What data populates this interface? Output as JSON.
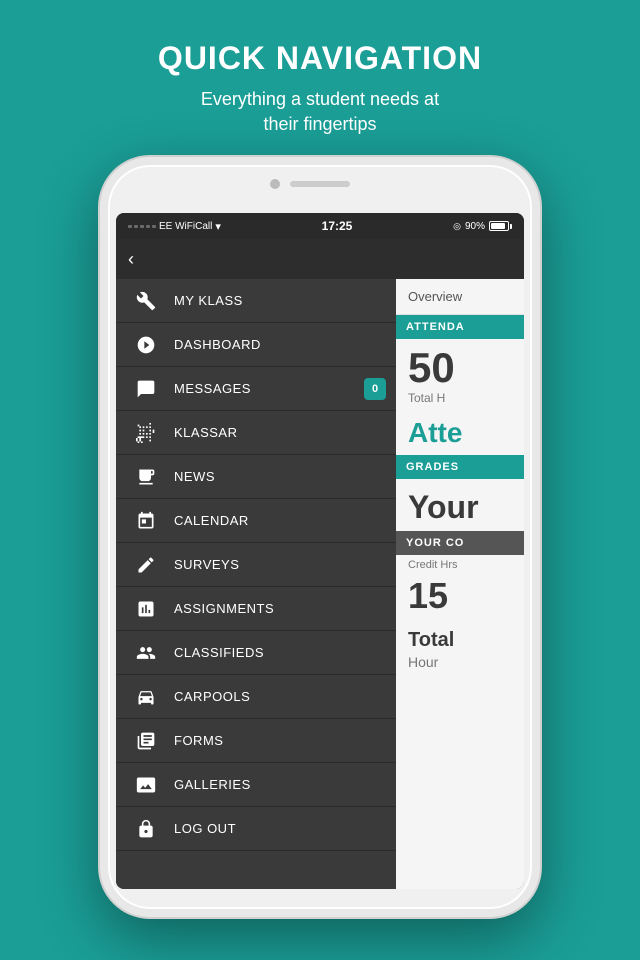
{
  "page": {
    "title": "QUICK NAVIGATION",
    "subtitle": "Everything a student needs at\ntheir fingertips"
  },
  "statusBar": {
    "carrier": "EE WiFiCall",
    "time": "17:25",
    "battery": "90%",
    "signal": "●●●●○"
  },
  "navBar": {
    "backLabel": "‹"
  },
  "menu": {
    "items": [
      {
        "id": "my-klass",
        "label": "MY KLASS",
        "icon": "wrench",
        "badge": null
      },
      {
        "id": "dashboard",
        "label": "DASHBOARD",
        "icon": "dashboard",
        "badge": null
      },
      {
        "id": "messages",
        "label": "MESSAGES",
        "icon": "chat",
        "badge": "0"
      },
      {
        "id": "klassar",
        "label": "KlassAR",
        "icon": "scan",
        "badge": null
      },
      {
        "id": "news",
        "label": "NEWS",
        "icon": "news",
        "badge": null
      },
      {
        "id": "calendar",
        "label": "CALENDAR",
        "icon": "calendar",
        "badge": null
      },
      {
        "id": "surveys",
        "label": "SURVEYS",
        "icon": "pencil",
        "badge": null
      },
      {
        "id": "assignments",
        "label": "ASSIGNMENTS",
        "icon": "assignment",
        "badge": null
      },
      {
        "id": "classifieds",
        "label": "CLASSIFIEDS",
        "icon": "classifieds",
        "badge": null
      },
      {
        "id": "carpools",
        "label": "CARPOOLS",
        "icon": "car",
        "badge": null
      },
      {
        "id": "forms",
        "label": "FORMS",
        "icon": "forms",
        "badge": null
      },
      {
        "id": "galleries",
        "label": "GALLERIES",
        "icon": "gallery",
        "badge": null
      },
      {
        "id": "logout",
        "label": "LOG OUT",
        "icon": "lock",
        "badge": null
      }
    ]
  },
  "overview": {
    "title": "Overview",
    "sections": [
      {
        "header": "ATTENDA",
        "stat": "50",
        "statLabel": "Total H",
        "text": "Atte"
      },
      {
        "header": "GRADES",
        "text": "Your"
      },
      {
        "header": "YOUR CO",
        "creditLabel": "Credit Hrs",
        "credit": "15",
        "totalLabel": "Total",
        "totalSub": "Hour"
      }
    ]
  }
}
